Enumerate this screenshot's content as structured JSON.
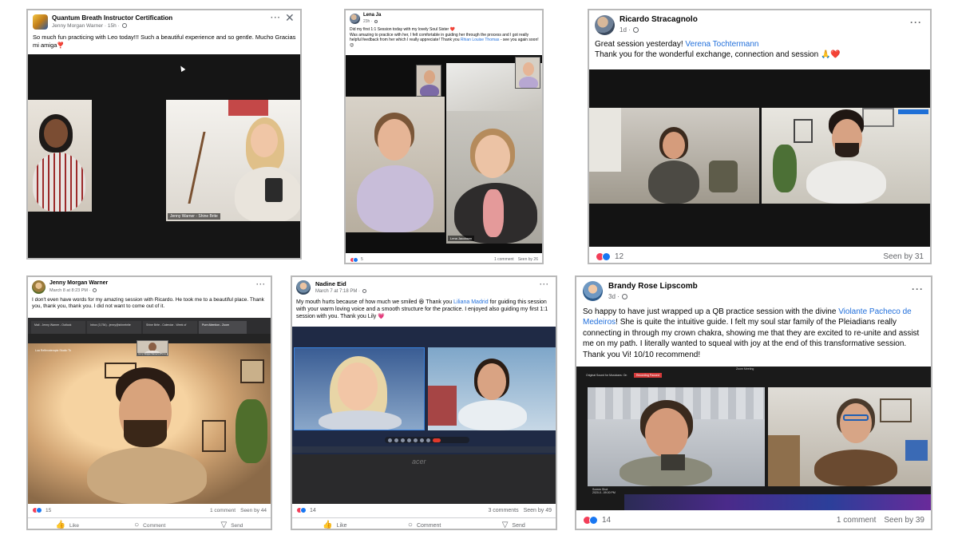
{
  "posts": [
    {
      "author": "Quantum Breath Instructor Certification",
      "meta": "Jenny Morgan Warner · 15h ·",
      "text": "So much fun practicing with Leo today!!! Such a beautiful experience and so gentle.  Mucho Gracias mi amiga❣️",
      "video_label": "Jenny Warner - Shine Brite"
    },
    {
      "author": "Lena Ja",
      "meta": "23h ·",
      "text_a": "Did my first 1:1 Session today with my lovely Soul Sister ❤️\nWas amazing to practice with her, I felt comfortable in guiding her through the process and I got really helpful feedback from her which I really appreciate! Thank you ",
      "text_link": "Rhian Louise Thomas",
      "text_b": " - see you again soon! 😊",
      "video_label": "Lena Jacobsen",
      "reaction_count": "5",
      "comments": "1 comment",
      "seen": "Seen by 26"
    },
    {
      "author": "Ricardo Stracagnolo",
      "meta": "1d ·",
      "text_a": "Great session yesterday! ",
      "text_link": "Verena Tochtermann",
      "text_b": "\nThank you for the wonderful exchange, connection and session 🙏❤️",
      "reaction_count": "12",
      "seen": "Seen by 31"
    },
    {
      "author": "Jenny Morgan Warner",
      "meta": "March 8 at 8:23 PM ·",
      "text": "I don't even have words for my amazing session with Ricardo.  He took me to a beautiful place. Thank you, thank you, thank you.  I did not want to come out of it.",
      "browser_tabs": [
        "Mail - Jenny Warner - Outlook",
        "Inbox (3,754) - jenny@shinebrite",
        "Shine Brite - Calendar - Week of",
        "Pure Attention - Zoom"
      ],
      "tile_label": "Jenny Morgan Warner's iPhone",
      "video_label": "Lua Reflexoterapia Studio Tk",
      "reaction_count": "15",
      "comments": "1 comment",
      "seen": "Seen by 44",
      "actions": [
        "Like",
        "Comment",
        "Send"
      ]
    },
    {
      "author": "Nadine Eid",
      "meta": "March 7 at 7:18 PM ·",
      "text_a": "My mouth hurts because of how much we smiled 😆  Thank you ",
      "text_link": "Liliana Madrid",
      "text_b": " for guiding this session with your warm loving voice and a smooth structure for the practice. I enjoyed also guiding my first 1:1 session with you. Thank you Lily 💗",
      "laptop_brand": "acer",
      "reaction_count": "14",
      "comments": "3 comments",
      "seen": "Seen by 49",
      "actions": [
        "Like",
        "Comment",
        "Send"
      ]
    },
    {
      "author": "Brandy Rose Lipscomb",
      "meta": "3d ·",
      "text_a": "So happy to have just wrapped up a QB practice session with the divine ",
      "text_link": "Violante Pacheco de Medeiros",
      "text_b": "! She is quite the intuitive guide. I felt my soul star family of the Pleiadians really connecting in through my crown chakra, showing me that they are excited to re-unite and assist me on my path. I literally wanted to squeal with joy at the end of this transformative session. Thank you Vi! 10/10 recommend!",
      "zoom_title": "Zoom Meeting",
      "zoom_left": "Original Sound for Musicians: On",
      "zoom_recording": "Recording Paused",
      "zoom_screenshot": "Screen Shot\n2020-0...09.00 PM",
      "reaction_count": "14",
      "comments": "1 comment",
      "seen": "Seen by 39"
    }
  ],
  "icons": {
    "more": "more-options-icon",
    "close": "close-icon",
    "globe": "globe-icon",
    "like": "like-icon",
    "comment": "comment-icon",
    "send": "send-icon"
  },
  "colors": {
    "link": "#216fdb",
    "love": "#f33e58",
    "like": "#1877f2",
    "muted": "#65676b"
  }
}
